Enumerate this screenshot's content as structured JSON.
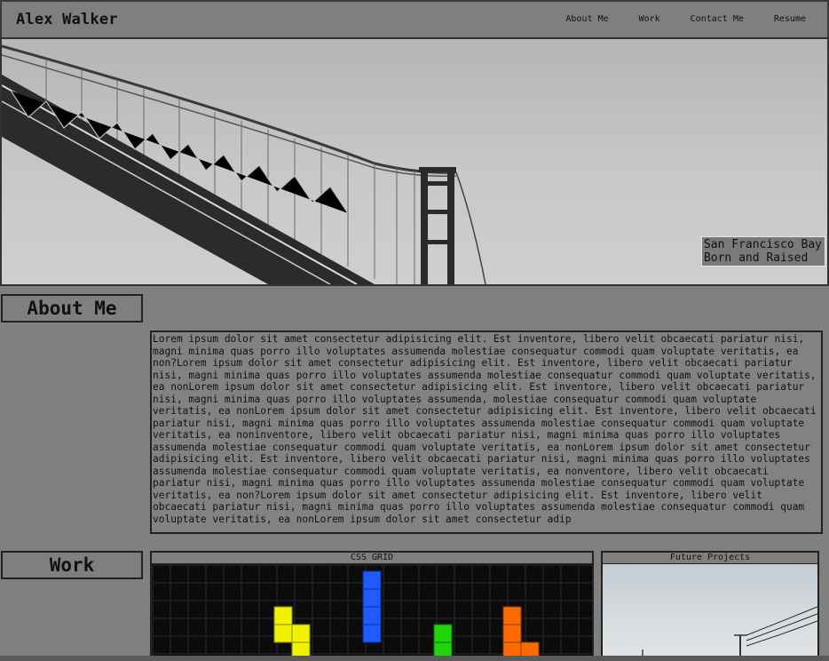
{
  "header": {
    "brand": "Alex Walker",
    "menu": [
      "About Me",
      "Work",
      "Contact Me",
      "Resume"
    ]
  },
  "hero": {
    "caption_line1": "San Francisco Bay",
    "caption_line2": "Born and Raised"
  },
  "about": {
    "label": "About Me",
    "text": "Lorem ipsum dolor sit amet consectetur adipisicing elit. Est inventore, libero velit obcaecati pariatur nisi, magni minima quas porro illo voluptates assumenda molestiae consequatur commodi quam voluptate veritatis, ea non?Lorem ipsum dolor sit amet consectetur adipisicing elit. Est inventore, libero velit obcaecati pariatur nisi, magni minima quas porro illo voluptates assumenda molestiae consequatur commodi quam voluptate veritatis, ea nonLorem ipsum dolor sit amet consectetur adipisicing elit. Est inventore, libero velit obcaecati pariatur nisi, magni minima quas porro illo voluptates assumenda, molestiae consequatur commodi quam voluptate veritatis, ea nonLorem ipsum dolor sit amet consectetur adipisicing elit. Est inventore, libero velit obcaecati pariatur nisi, magni minima quas porro illo voluptates assumenda molestiae consequatur commodi quam voluptate veritatis, ea noninventore, libero velit obcaecati pariatur nisi, magni minima quas porro illo voluptates assumenda molestiae consequatur commodi quam voluptate veritatis, ea nonLorem ipsum dolor sit amet consectetur adipisicing elit. Est inventore, libero velit obcaecati pariatur nisi, magni minima quas porro illo voluptates assumenda molestiae consequatur commodi quam voluptate veritatis, ea nonventore, libero velit obcaecati pariatur nisi, magni minima quas porro illo voluptates assumenda molestiae consequatur commodi quam voluptate veritatis, ea non?Lorem ipsum dolor sit amet consectetur adipisicing elit. Est inventore, libero velit obcaecati pariatur nisi, magni minima quas porro illo voluptates assumenda molestiae consequatur commodi quam voluptate veritatis, ea nonLorem ipsum dolor sit amet consectetur adip"
  },
  "work": {
    "label": "Work",
    "cards": [
      {
        "title": "CSS GRID"
      },
      {
        "title": "Future Projects"
      }
    ]
  },
  "colors": {
    "page_bg": "#808080",
    "tetris_yellow": "#f2f200",
    "tetris_blue": "#1f5bff",
    "tetris_green": "#22d40a",
    "tetris_orange": "#ff6a00"
  }
}
